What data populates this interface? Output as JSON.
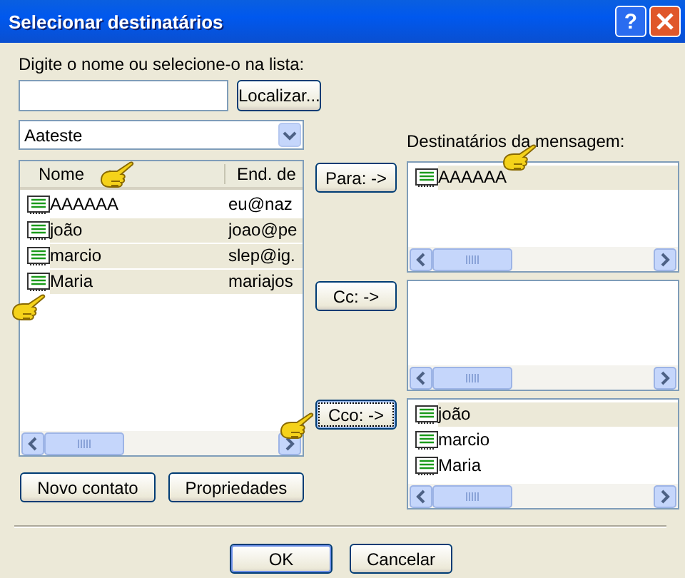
{
  "window": {
    "title": "Selecionar destinatários",
    "help_glyph": "?"
  },
  "search": {
    "label": "Digite o nome ou selecione-o na lista:",
    "button": "Localizar..."
  },
  "address_book": {
    "value": "Aateste"
  },
  "contacts": {
    "columns": [
      "Nome",
      "End. de"
    ],
    "rows": [
      {
        "name": "AAAAAA",
        "email": "eu@naz",
        "selected": false
      },
      {
        "name": "joão",
        "email": "joao@pe",
        "selected": true
      },
      {
        "name": "marcio",
        "email": "slep@ig.",
        "selected": true
      },
      {
        "name": "Maria",
        "email": "mariajos",
        "selected": true
      }
    ]
  },
  "recipients_label": "Destinatários da mensagem:",
  "recipient_lists": [
    {
      "button": "Para: ->",
      "focused": false,
      "items": [
        {
          "name": "AAAAAA",
          "selected": true
        }
      ]
    },
    {
      "button": "Cc: ->",
      "focused": false
    },
    {
      "button": "Cco: ->",
      "focused": true,
      "items": [
        {
          "name": "joão",
          "selected": true
        },
        {
          "name": "marcio",
          "selected": false
        },
        {
          "name": "Maria",
          "selected": false
        }
      ]
    }
  ],
  "left_buttons": [
    "Novo contato",
    "Propriedades"
  ],
  "dialog_buttons": [
    {
      "label": "OK",
      "default": true
    },
    {
      "label": "Cancelar",
      "default": false
    }
  ]
}
